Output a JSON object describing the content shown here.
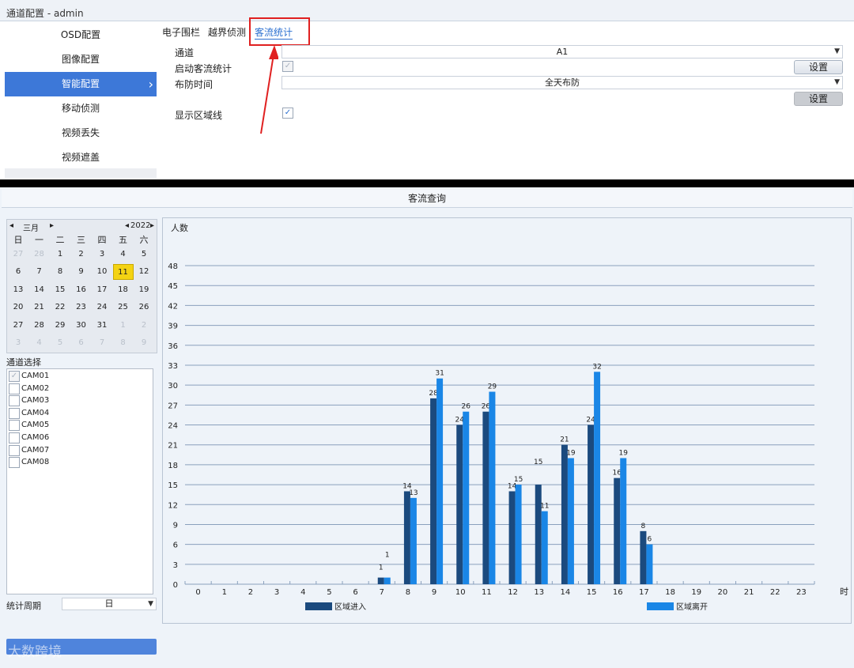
{
  "top": {
    "title": "通道配置 - admin",
    "sidebar": [
      {
        "label": "OSD配置",
        "active": false
      },
      {
        "label": "图像配置",
        "active": false
      },
      {
        "label": "智能配置",
        "active": true
      },
      {
        "label": "移动侦测",
        "active": false
      },
      {
        "label": "视频丢失",
        "active": false
      },
      {
        "label": "视频遮盖",
        "active": false
      }
    ],
    "tabs": [
      {
        "label": "电子围栏",
        "active": false
      },
      {
        "label": "越界侦测",
        "active": false
      },
      {
        "label": "客流统计",
        "active": true
      }
    ],
    "form": {
      "channel_label": "通道",
      "channel_value": "A1",
      "enable_label": "启动客流统计",
      "enable_checked": true,
      "settings_label": "设置",
      "schedule_label": "布防时间",
      "schedule_value": "全天布防",
      "schedule_settings_label": "设置",
      "show_line_label": "显示区域线",
      "show_line_checked": true
    }
  },
  "bottom": {
    "title": "客流查询",
    "calendar": {
      "month": "三月",
      "year": "2022",
      "weekdays": [
        "日",
        "一",
        "二",
        "三",
        "四",
        "五",
        "六"
      ],
      "weeks": [
        [
          {
            "d": "27",
            "m": true
          },
          {
            "d": "28",
            "m": true
          },
          {
            "d": "1"
          },
          {
            "d": "2"
          },
          {
            "d": "3"
          },
          {
            "d": "4"
          },
          {
            "d": "5"
          }
        ],
        [
          {
            "d": "6"
          },
          {
            "d": "7"
          },
          {
            "d": "8"
          },
          {
            "d": "9"
          },
          {
            "d": "10"
          },
          {
            "d": "11",
            "s": true
          },
          {
            "d": "12"
          }
        ],
        [
          {
            "d": "13"
          },
          {
            "d": "14"
          },
          {
            "d": "15"
          },
          {
            "d": "16"
          },
          {
            "d": "17"
          },
          {
            "d": "18"
          },
          {
            "d": "19"
          }
        ],
        [
          {
            "d": "20"
          },
          {
            "d": "21"
          },
          {
            "d": "22"
          },
          {
            "d": "23"
          },
          {
            "d": "24"
          },
          {
            "d": "25"
          },
          {
            "d": "26"
          }
        ],
        [
          {
            "d": "27"
          },
          {
            "d": "28"
          },
          {
            "d": "29"
          },
          {
            "d": "30"
          },
          {
            "d": "31"
          },
          {
            "d": "1",
            "m": true
          },
          {
            "d": "2",
            "m": true
          }
        ],
        [
          {
            "d": "3",
            "m": true
          },
          {
            "d": "4",
            "m": true
          },
          {
            "d": "5",
            "m": true
          },
          {
            "d": "6",
            "m": true
          },
          {
            "d": "7",
            "m": true
          },
          {
            "d": "8",
            "m": true
          },
          {
            "d": "9",
            "m": true
          }
        ]
      ]
    },
    "channel_select_label": "通道选择",
    "channels": [
      {
        "name": "CAM01",
        "checked": true
      },
      {
        "name": "CAM02",
        "checked": false
      },
      {
        "name": "CAM03",
        "checked": false
      },
      {
        "name": "CAM04",
        "checked": false
      },
      {
        "name": "CAM05",
        "checked": false
      },
      {
        "name": "CAM06",
        "checked": false
      },
      {
        "name": "CAM07",
        "checked": false
      },
      {
        "name": "CAM08",
        "checked": false
      }
    ],
    "period_label": "统计周期",
    "period_value": "日",
    "watermark": "大数跨境"
  },
  "colors": {
    "enter": "#1b4a7e",
    "leave": "#1a86e6",
    "accent": "#3d78d8",
    "highlight": "#f4d313",
    "annotation": "#e02020"
  },
  "chart_data": {
    "type": "bar",
    "ylabel": "人数",
    "xlabel": "时",
    "yticks": [
      0,
      3,
      6,
      9,
      12,
      15,
      18,
      21,
      24,
      27,
      30,
      33,
      36,
      39,
      42,
      45,
      48
    ],
    "ylim": [
      0,
      48
    ],
    "grid": true,
    "categories": [
      "0",
      "1",
      "2",
      "3",
      "4",
      "5",
      "6",
      "7",
      "8",
      "9",
      "10",
      "11",
      "12",
      "13",
      "14",
      "15",
      "16",
      "17",
      "18",
      "19",
      "20",
      "21",
      "22",
      "23"
    ],
    "series": [
      {
        "name": "区域进入",
        "color": "#1b4a7e",
        "values": [
          0,
          0,
          0,
          0,
          0,
          0,
          0,
          1,
          14,
          28,
          24,
          26,
          14,
          15,
          21,
          24,
          16,
          8,
          0,
          0,
          0,
          0,
          0,
          0
        ]
      },
      {
        "name": "区域离开",
        "color": "#1a86e6",
        "values": [
          0,
          0,
          0,
          0,
          0,
          0,
          0,
          1,
          13,
          31,
          26,
          29,
          15,
          11,
          19,
          32,
          19,
          6,
          0,
          0,
          0,
          0,
          0,
          0
        ]
      }
    ],
    "legend_position": "bottom"
  }
}
